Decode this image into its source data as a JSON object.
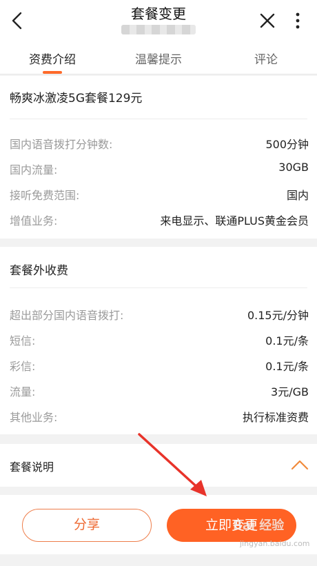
{
  "header": {
    "title": "套餐变更"
  },
  "tabs": [
    {
      "label": "资费介绍",
      "active": true
    },
    {
      "label": "温馨提示",
      "active": false
    },
    {
      "label": "评论",
      "active": false
    }
  ],
  "plan": {
    "name": "畅爽冰激凌5G套餐129元",
    "rows": [
      {
        "label": "国内语音拨打分钟数:",
        "value": "500分钟"
      },
      {
        "label": "国内流量:",
        "value": "30GB"
      },
      {
        "label": "接听免费范围:",
        "value": "国内"
      },
      {
        "label": "增值业务:",
        "value": "来电显示、联通PLUS黄金会员"
      }
    ]
  },
  "extra_fees": {
    "title": "套餐外收费",
    "rows": [
      {
        "label": "超出部分国内语音拨打:",
        "value": "0.15元/分钟"
      },
      {
        "label": "短信:",
        "value": "0.1元/条"
      },
      {
        "label": "彩信:",
        "value": "0.1元/条"
      },
      {
        "label": "流量:",
        "value": "3元/GB"
      },
      {
        "label": "其他业务:",
        "value": "执行标准资费"
      }
    ]
  },
  "description": {
    "title": "套餐说明"
  },
  "actions": {
    "share_label": "分享",
    "change_label": "立即变更"
  },
  "watermark": {
    "text": "Bai 经验",
    "sub": "jingyan.baidu.com"
  },
  "colors": {
    "accent": "#ff6224",
    "tab_indicator": "#ff6a2a",
    "arrow": "#e8332a"
  }
}
